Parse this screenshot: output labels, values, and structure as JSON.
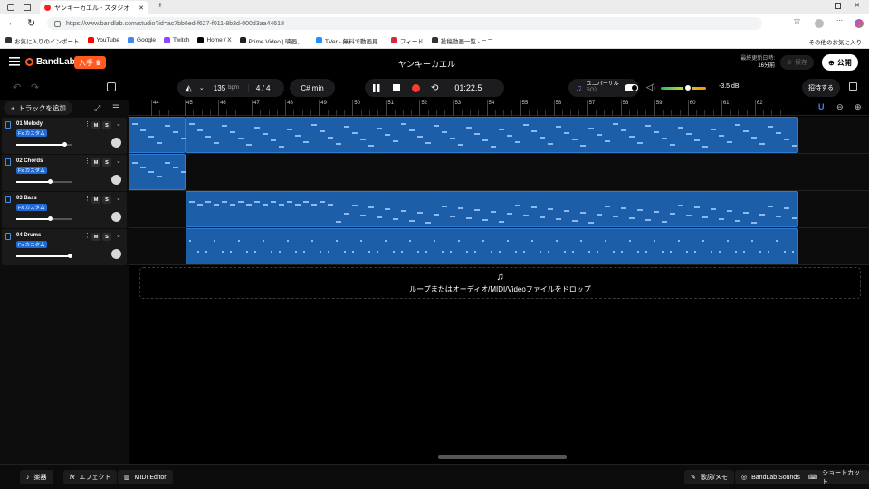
{
  "browser": {
    "tab_title": "ヤンキーカエル - スタジオ",
    "url": "https://www.bandlab.com/studio?id=ac7bb6ed-f627-f011-8b3d-000d3aa44618",
    "bookmarks": [
      {
        "label": "お気に入りのインポート",
        "icon": "import-icon",
        "color": "#333333"
      },
      {
        "label": "YouTube",
        "icon": "youtube-icon",
        "color": "#ff0000"
      },
      {
        "label": "Google",
        "icon": "google-icon",
        "color": "#4285f4"
      },
      {
        "label": "Twitch",
        "icon": "twitch-icon",
        "color": "#9146ff"
      },
      {
        "label": "Home / X",
        "icon": "x-icon",
        "color": "#000000"
      },
      {
        "label": "Prime Video | 映画、...",
        "icon": "amazon-icon",
        "color": "#222222"
      },
      {
        "label": "TVer - 無料で動画見...",
        "icon": "tver-icon",
        "color": "#1e90ff"
      },
      {
        "label": "フィード",
        "icon": "feed-icon",
        "color": "#d7263d"
      },
      {
        "label": "投稿動画一覧 - ニコ...",
        "icon": "nico-icon",
        "color": "#333333"
      }
    ],
    "other_bookmarks": "その他のお気に入り"
  },
  "app": {
    "logo": "BandLab",
    "join_label": "入手",
    "project_title": "ヤンキーカエル",
    "save_status_line1": "最終更新日時:",
    "save_status_line2": "16分前",
    "save_label": "保存",
    "publish_label": "公開",
    "invite_label": "招待する"
  },
  "toolbar": {
    "bpm": "135",
    "bpm_unit": "bpm",
    "time_sig_top": "4",
    "time_sig_bottom": "4",
    "key": "C# min",
    "time": "01:22.5",
    "instrument_name": "ユニバーサル",
    "instrument_sub": "SO〉",
    "volume_db": "-3.5 dB",
    "master_volume": 0.6
  },
  "tracks": {
    "add_label": "トラックを追加",
    "mute_label": "M",
    "solo_label": "S",
    "fx_label": "Fx カスタム",
    "list": [
      {
        "name": "01  Melody",
        "icon": "keyboard-icon",
        "volume": 0.85
      },
      {
        "name": "02  Chords",
        "icon": "keyboard-icon",
        "volume": 0.6
      },
      {
        "name": "03  Bass",
        "icon": "bass-icon",
        "volume": 0.6
      },
      {
        "name": "04  Drums",
        "icon": "drum-icon",
        "volume": 0.95
      }
    ]
  },
  "ruler": {
    "bars": [
      "44",
      "45",
      "46",
      "47",
      "48",
      "49",
      "50",
      "51",
      "52",
      "53",
      "54",
      "55",
      "56",
      "57",
      "58",
      "59",
      "60",
      "61",
      "62"
    ],
    "playhead_bar": 47.3
  },
  "drop_zone_text": "ループまたはオーディオ/MIDI/Videoファイルをドロップ",
  "footer": {
    "instruments": "楽器",
    "effects": "エフェクト",
    "midi_editor": "MIDI Editor",
    "lyrics": "歌詞/メモ",
    "sounds": "BandLab Sounds",
    "shortcuts": "ショートカット"
  },
  "colors": {
    "accent": "#1e6ad6",
    "clip": "#1d5ea8",
    "record": "#ff3b30",
    "join": "#ff5a1f"
  }
}
